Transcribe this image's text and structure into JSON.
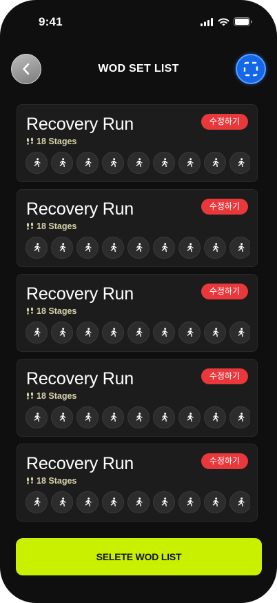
{
  "status_bar": {
    "time": "9:41"
  },
  "header": {
    "title": "WOD SET LIST",
    "back_icon": "chevron-left-icon",
    "scan_icon": "scan-frame-icon"
  },
  "cards": [
    {
      "title": "Recovery Run",
      "stages_label": "18 Stages",
      "edit_label": "수정하기"
    },
    {
      "title": "Recovery Run",
      "stages_label": "18 Stages",
      "edit_label": "수정하기"
    },
    {
      "title": "Recovery Run",
      "stages_label": "18 Stages",
      "edit_label": "수정하기"
    },
    {
      "title": "Recovery Run",
      "stages_label": "18 Stages",
      "edit_label": "수정하기"
    },
    {
      "title": "Recovery Run",
      "stages_label": "18 Stages",
      "edit_label": "수정하기"
    }
  ],
  "footer": {
    "button_label": "SELETE WOD LIST"
  },
  "colors": {
    "accent": "#C8F000",
    "edit_badge": "#E8383C",
    "scan_button": "#1468E8",
    "background": "#0F0F0F",
    "card": "#1C1C1C"
  }
}
